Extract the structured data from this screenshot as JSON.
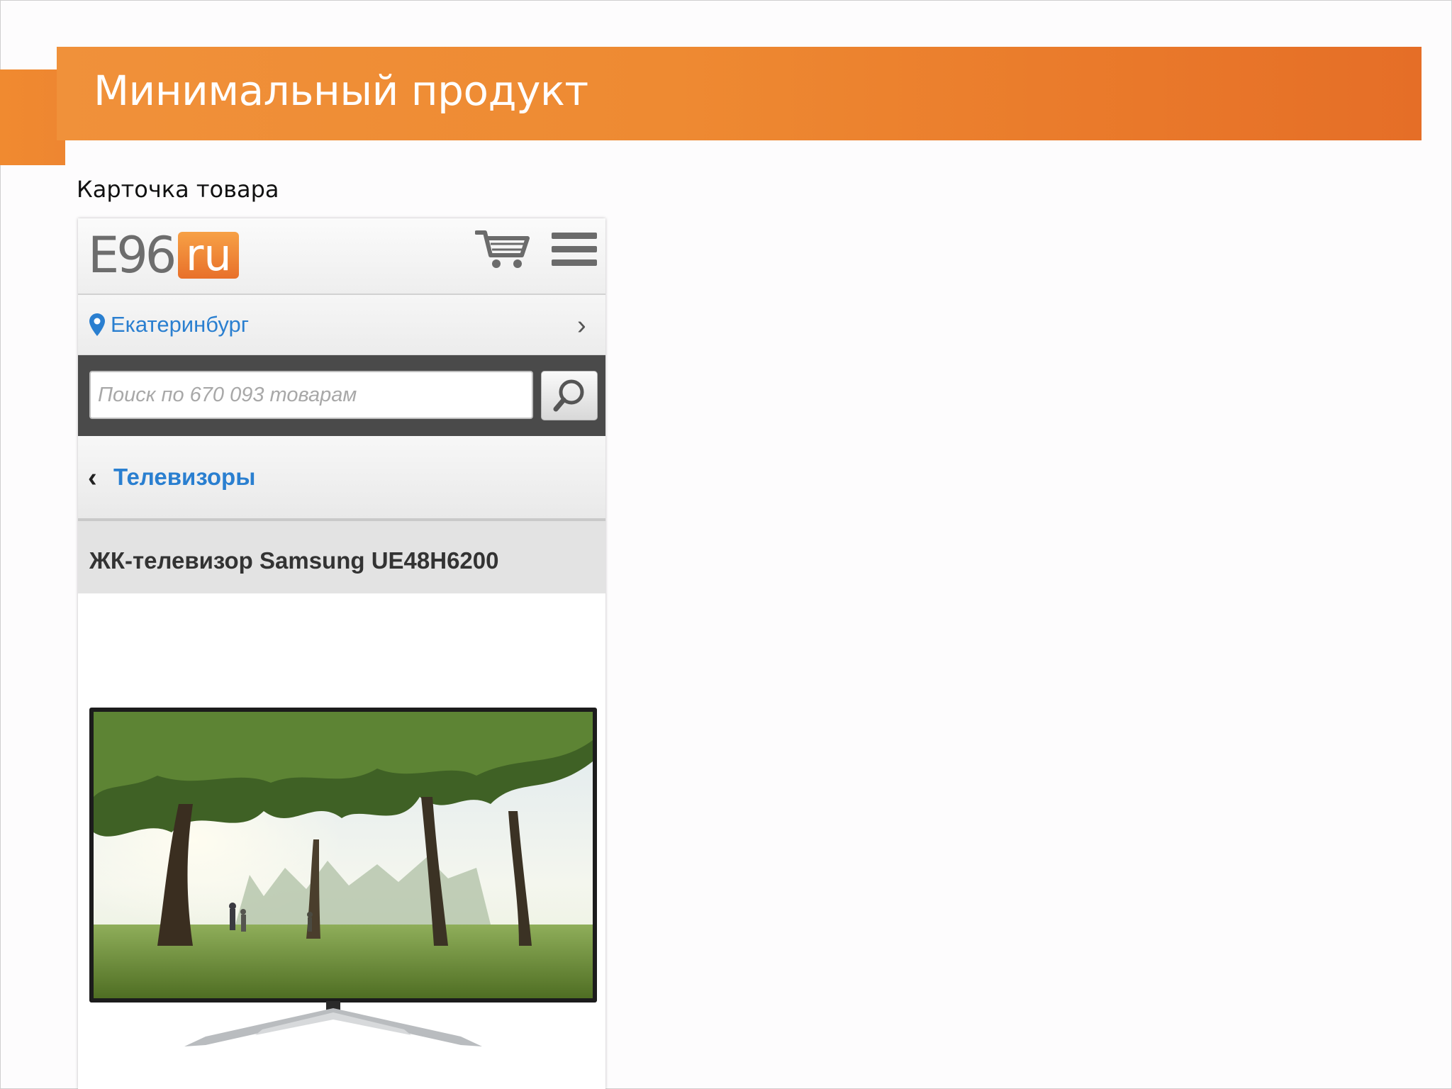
{
  "slide": {
    "title": "Минимальный продукт",
    "subtitle": "Карточка товара",
    "accent_color": "#ee8631"
  },
  "site": {
    "logo_main": "E96",
    "logo_badge": "ru",
    "cart_icon": "cart-icon",
    "menu_icon": "hamburger-menu-icon"
  },
  "location": {
    "city": "Екатеринбург",
    "icon": "map-pin-icon"
  },
  "search": {
    "placeholder": "Поиск по 670 093 товарам",
    "button_icon": "search-icon"
  },
  "breadcrumb": {
    "category": "Телевизоры"
  },
  "product": {
    "title": "ЖК-телевизор Samsung UE48H6200",
    "image_alt": "tv-image"
  },
  "colors": {
    "link": "#2a7fd0",
    "search_bg": "#4a4a4a"
  }
}
